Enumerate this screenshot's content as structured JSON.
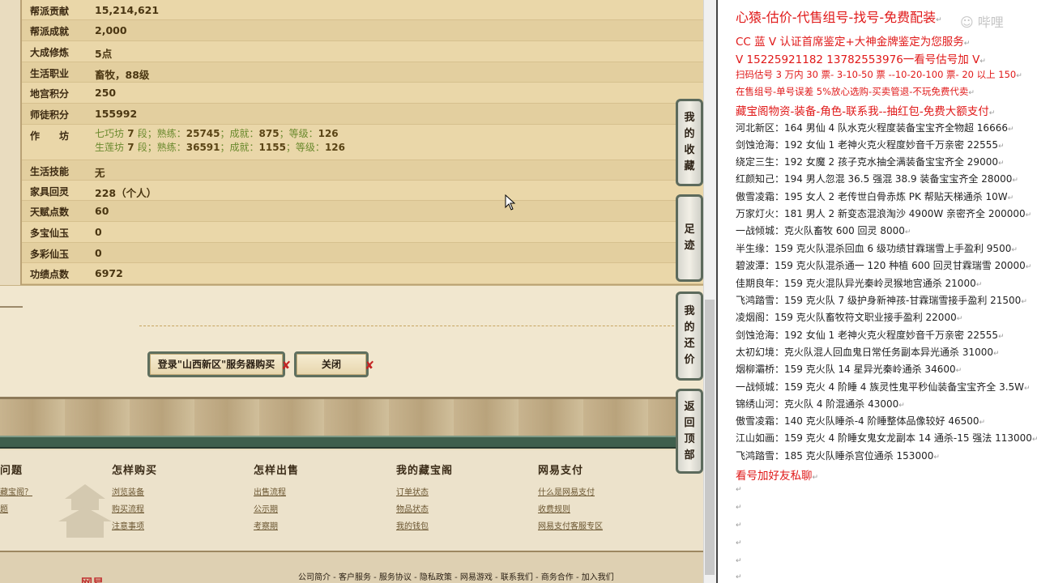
{
  "profile_rows": [
    {
      "label": "帮派贡献",
      "value": "15,214,621"
    },
    {
      "label": "帮派成就",
      "value": "2,000"
    },
    {
      "label": "大成修炼",
      "value": "5点"
    },
    {
      "label": "生活职业",
      "value": "畜牧，88级"
    },
    {
      "label": "地宫积分",
      "value": "250"
    },
    {
      "label": "师徒积分",
      "value": "155992"
    },
    {
      "label": "作　　坊",
      "value": ""
    },
    {
      "label": "生活技能",
      "value": "无"
    },
    {
      "label": "家具回灵",
      "value": "228（个人）"
    },
    {
      "label": "天赋点数",
      "value": "60"
    },
    {
      "label": "多宝仙玉",
      "value": "0"
    },
    {
      "label": "多彩仙玉",
      "value": "0"
    },
    {
      "label": "功绩点数",
      "value": "6972"
    }
  ],
  "workshop": [
    {
      "name": "七巧坊",
      "duan": "7",
      "duan_unit": "段；熟练：",
      "skill": "25745",
      "ach_label": "；成就：",
      "ach": "875",
      "lvl_label": "；等级：",
      "lvl": "126"
    },
    {
      "name": "生莲坊",
      "duan": "7",
      "duan_unit": "段；熟练：",
      "skill": "36591",
      "ach_label": "；成就：",
      "ach": "1155",
      "lvl_label": "；等级：",
      "lvl": "126"
    }
  ],
  "buttons": {
    "login": "登录\"山西新区\"服务器购买",
    "close": "关闭"
  },
  "side_tabs": [
    {
      "id": "favorites",
      "label": "我的收藏"
    },
    {
      "id": "footprint",
      "label": "足迹"
    },
    {
      "id": "bargain",
      "label": "我的还价"
    },
    {
      "id": "top",
      "label": "返回顶部"
    }
  ],
  "footer": {
    "columns": [
      {
        "title": "问题",
        "links": [
          "藏宝阁？",
          "题"
        ]
      },
      {
        "title": "怎样购买",
        "links": [
          "浏览装备",
          "购买流程",
          "注意事项"
        ]
      },
      {
        "title": "怎样出售",
        "links": [
          "出售流程",
          "公示期",
          "考察期"
        ]
      },
      {
        "title": "我的藏宝阁",
        "links": [
          "订单状态",
          "物品状态",
          "我的钱包"
        ]
      },
      {
        "title": "网易支付",
        "links": [
          "什么是网易支付",
          "收费规则",
          "网易支付客服专区"
        ]
      }
    ],
    "bottom_links": "公司简介 - 客户服务 - 服务协议 - 隐私政策 - 网易游戏 - 联系我们 - 商务合作 - 加入我们"
  },
  "document": {
    "watermark": "☺ 哔哩",
    "lines": [
      {
        "text": "心猿-估价-代售组号-找号-免费配装",
        "style": "red big"
      },
      {
        "text": "CC 蓝 V 认证首席鉴定+大神金牌鉴定为您服务",
        "style": "red mid"
      },
      {
        "text": "V 15225921182     13782553976一看号估号加 V",
        "style": "red mid"
      },
      {
        "text": "扫码估号 3 万内 30 票- 3-10-50 票 --10-20-100 票- 20 以上 150",
        "style": "red sm"
      },
      {
        "text": "在售组号-单号误差 5%放心选购-买卖管退-不玩免费代卖",
        "style": "red sm"
      },
      {
        "text": "藏宝阁物资-装备-角色-联系我--抽红包-免费大额支付",
        "style": "red mid"
      },
      {
        "text": "河北新区：164 男仙 4 队水克火程度装备宝宝齐全物超 16666",
        "style": ""
      },
      {
        "text": "剑蚀沧海：192 女仙 1 老神火克火程度妙音千万亲密 22555",
        "style": ""
      },
      {
        "text": "绕定三生：192 女魔 2 孩子克水抽全满装备宝宝齐全 29000",
        "style": ""
      },
      {
        "text": "红颜知己：194 男人忽混 36.5 强混 38.9 装备宝宝齐全 28000",
        "style": ""
      },
      {
        "text": "傲雪凌霜：195 女人 2 老传世白骨赤炼 PK 帮贴天梯通杀 10W",
        "style": ""
      },
      {
        "text": "万家灯火：181 男人 2 新变态混浪淘沙 4900W 亲密齐全 200000",
        "style": ""
      },
      {
        "text": "一战倾城：克火队畜牧 600 回灵 8000",
        "style": ""
      },
      {
        "text": "半生缘：159 克火队混杀回血 6 级功绩甘霖瑞雪上手盈利 9500",
        "style": ""
      },
      {
        "text": "碧波潭：159 克火队混杀通一 120 种植 600 回灵甘霖瑞雪 20000",
        "style": ""
      },
      {
        "text": "佳期良年：159 克火混队异光秦岭灵猴地宫通杀 21000",
        "style": ""
      },
      {
        "text": "飞鸿踏雪：159 克火队 7 级护身新神孩-甘霖瑞雪接手盈利 21500",
        "style": ""
      },
      {
        "text": "凌烟阁：159 克火队畜牧符文职业接手盈利 22000",
        "style": ""
      },
      {
        "text": "剑蚀沧海：192 女仙 1 老神火克火程度妙音千万亲密 22555",
        "style": ""
      },
      {
        "text": "太初幻境：克火队混人回血鬼日常任务副本异光通杀 31000",
        "style": ""
      },
      {
        "text": "烟柳灞桥：159 克火队 14 星异光秦岭通杀 34600",
        "style": ""
      },
      {
        "text": "一战倾城：159 克火 4 阶睡 4 族灵性鬼平秒仙装备宝宝齐全 3.5W",
        "style": ""
      },
      {
        "text": "锦绣山河：克火队 4 阶混通杀 43000",
        "style": ""
      },
      {
        "text": "傲雪凌霜：140 克火队睡杀-4 阶睡整体品像较好 46500",
        "style": ""
      },
      {
        "text": "江山如画：159 克火 4 阶睡女鬼女龙副本 14 通杀-15 强法 113000",
        "style": ""
      },
      {
        "text": "飞鸿踏雪：185 克火队睡杀宫位通杀 153000",
        "style": ""
      },
      {
        "text": "看号加好友私聊",
        "style": "red mid"
      }
    ]
  }
}
